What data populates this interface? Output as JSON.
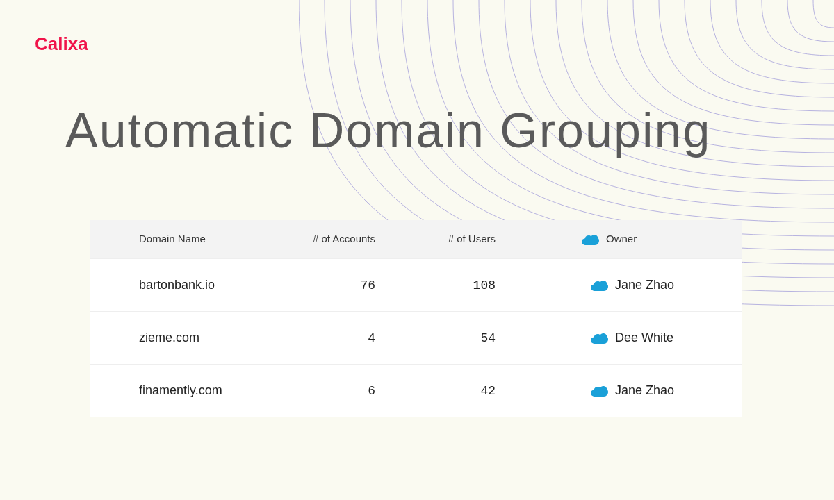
{
  "logo": "Calixa",
  "title": "Automatic Domain Grouping",
  "table": {
    "columns": [
      "Domain Name",
      "# of Accounts",
      "# of Users",
      "Owner"
    ],
    "rows": [
      [
        "bartonbank.io",
        "76",
        "108",
        "Jane Zhao"
      ],
      [
        "zieme.com",
        "4",
        "54",
        "Dee White"
      ],
      [
        "finamently.com",
        "6",
        "42",
        "Jane Zhao"
      ]
    ]
  }
}
